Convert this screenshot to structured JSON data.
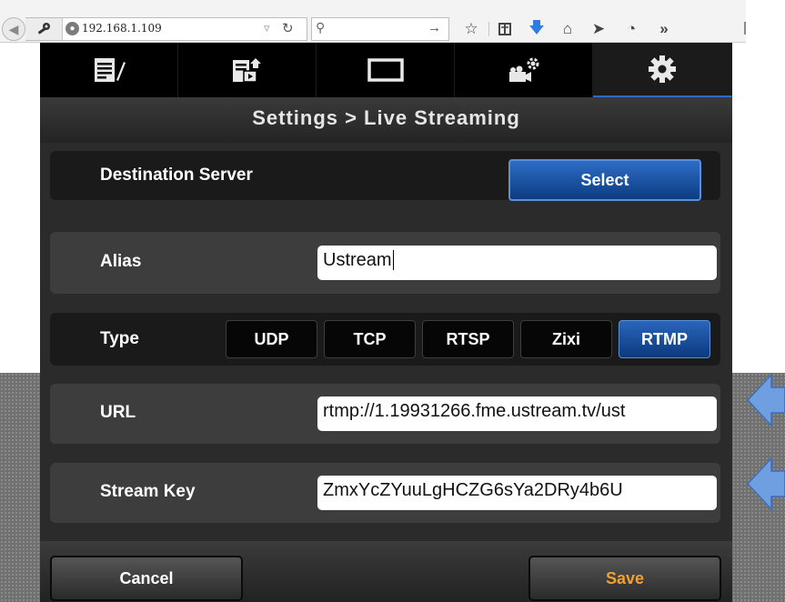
{
  "browser": {
    "url": "192.168.1.109",
    "search_placeholder": "",
    "toolbar_icons": [
      "bookmark-star-icon",
      "reading-list-icon",
      "download-arrow-icon",
      "home-icon",
      "send-icon",
      "history-clock-icon",
      "overflow-chevrons-icon"
    ],
    "overflow_glyph": "»"
  },
  "tabs": [
    {
      "icon": "edit-list-icon",
      "active": false
    },
    {
      "icon": "upload-media-icon",
      "active": false
    },
    {
      "icon": "display-monitor-icon",
      "active": false
    },
    {
      "icon": "camera-settings-icon",
      "active": false
    },
    {
      "icon": "settings-gear-icon",
      "active": true
    }
  ],
  "page": {
    "title": "Settings > Live Streaming",
    "destination_label": "Destination Server",
    "select_label": "Select",
    "alias_label": "Alias",
    "alias_value": "Ustream",
    "type_label": "Type",
    "type_options": [
      "UDP",
      "TCP",
      "RTSP",
      "Zixi",
      "RTMP"
    ],
    "type_selected": "RTMP",
    "url_label": "URL",
    "url_value": "rtmp://1.19931266.fme.ustream.tv/ust",
    "stream_key_label": "Stream Key",
    "stream_key_value": "ZmxYcZYuuLgHCZG6sYa2DRy4b6U",
    "cancel_label": "Cancel",
    "save_label": "Save"
  },
  "colors": {
    "accent_blue": "#2e6cc5",
    "save_text": "#f0a030",
    "annotation_arrow": "#6f9fe0"
  }
}
